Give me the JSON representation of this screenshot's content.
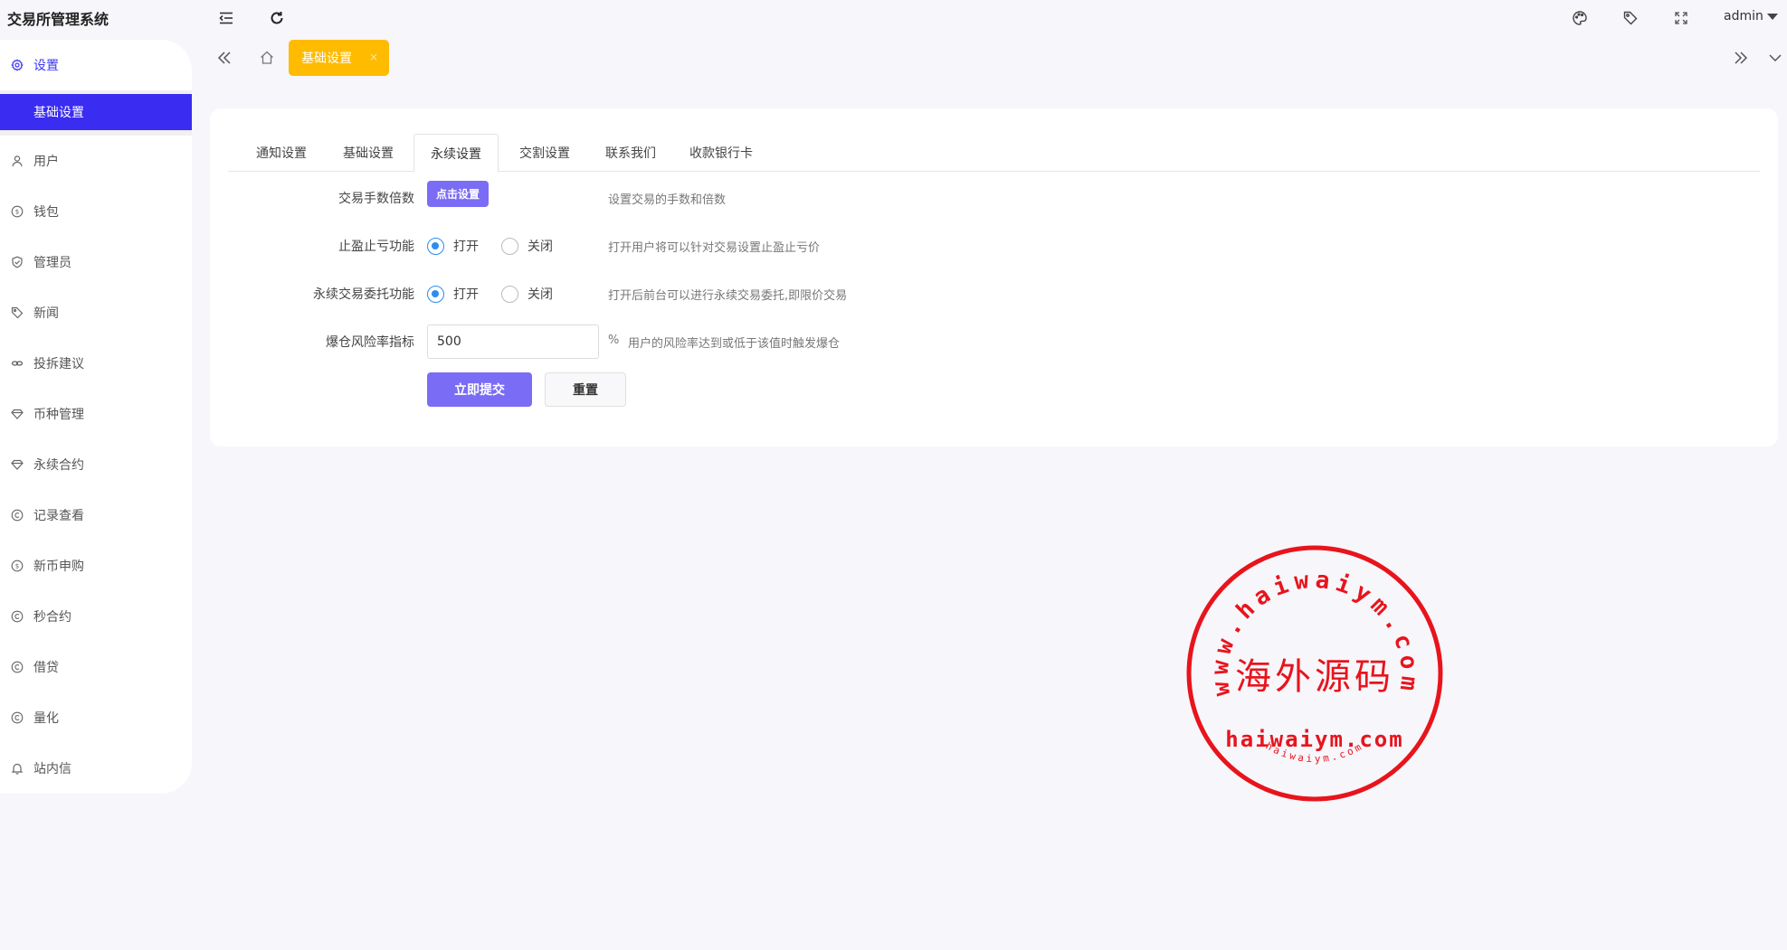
{
  "header": {
    "app_title": "交易所管理系统",
    "user": "admin",
    "icons": [
      "menu-fold-icon",
      "refresh-icon",
      "theme-palette-icon",
      "tag-icon",
      "fullscreen-icon"
    ]
  },
  "sidebar": {
    "items": [
      {
        "label": "设置",
        "icon": "gear-icon",
        "active": true
      },
      {
        "label": "用户",
        "icon": "user-icon"
      },
      {
        "label": "钱包",
        "icon": "dollar-icon"
      },
      {
        "label": "管理员",
        "icon": "shield-icon"
      },
      {
        "label": "新闻",
        "icon": "tag-icon"
      },
      {
        "label": "投拆建议",
        "icon": "link-icon"
      },
      {
        "label": "币种管理",
        "icon": "diamond-icon"
      },
      {
        "label": "永续合约",
        "icon": "diamond-icon"
      },
      {
        "label": "记录查看",
        "icon": "copyright-icon"
      },
      {
        "label": "新币申购",
        "icon": "dollar-icon"
      },
      {
        "label": "秒合约",
        "icon": "copyright-icon"
      },
      {
        "label": "借贷",
        "icon": "copyright-icon"
      },
      {
        "label": "量化",
        "icon": "copyright-icon"
      },
      {
        "label": "站内信",
        "icon": "bell-icon"
      }
    ],
    "submenu": {
      "label": "基础设置"
    }
  },
  "tabbar": {
    "active_tab": "基础设置",
    "close": "×"
  },
  "settings": {
    "tabs": [
      "通知设置",
      "基础设置",
      "永续设置",
      "交割设置",
      "联系我们",
      "收款银行卡"
    ],
    "active_tab_index": 2,
    "fields": {
      "fee_multiplier": {
        "label": "交易手数倍数",
        "button": "点击设置",
        "hint": "设置交易的手数和倍数"
      },
      "tp_sl": {
        "label": "止盈止亏功能",
        "on": "打开",
        "off": "关闭",
        "selected": "打开",
        "hint": "打开用户将可以针对交易设置止盈止亏价"
      },
      "perpetual_order": {
        "label": "永续交易委托功能",
        "on": "打开",
        "off": "关闭",
        "selected": "打开",
        "hint": "打开后前台可以进行永续交易委托,即限价交易"
      },
      "liquidation_risk": {
        "label": "爆仓风险率指标",
        "value": "500",
        "unit": "%",
        "hint": "用户的风险率达到或低于该值时触发爆仓"
      }
    },
    "submit": "立即提交",
    "reset": "重置"
  },
  "watermark": {
    "top_text": "www.haiwaiym.com",
    "center_text": "海外源码",
    "bottom_text": "haiwaiym.com",
    "small_text": "haiwaiym.com",
    "color": "#e8141c"
  }
}
